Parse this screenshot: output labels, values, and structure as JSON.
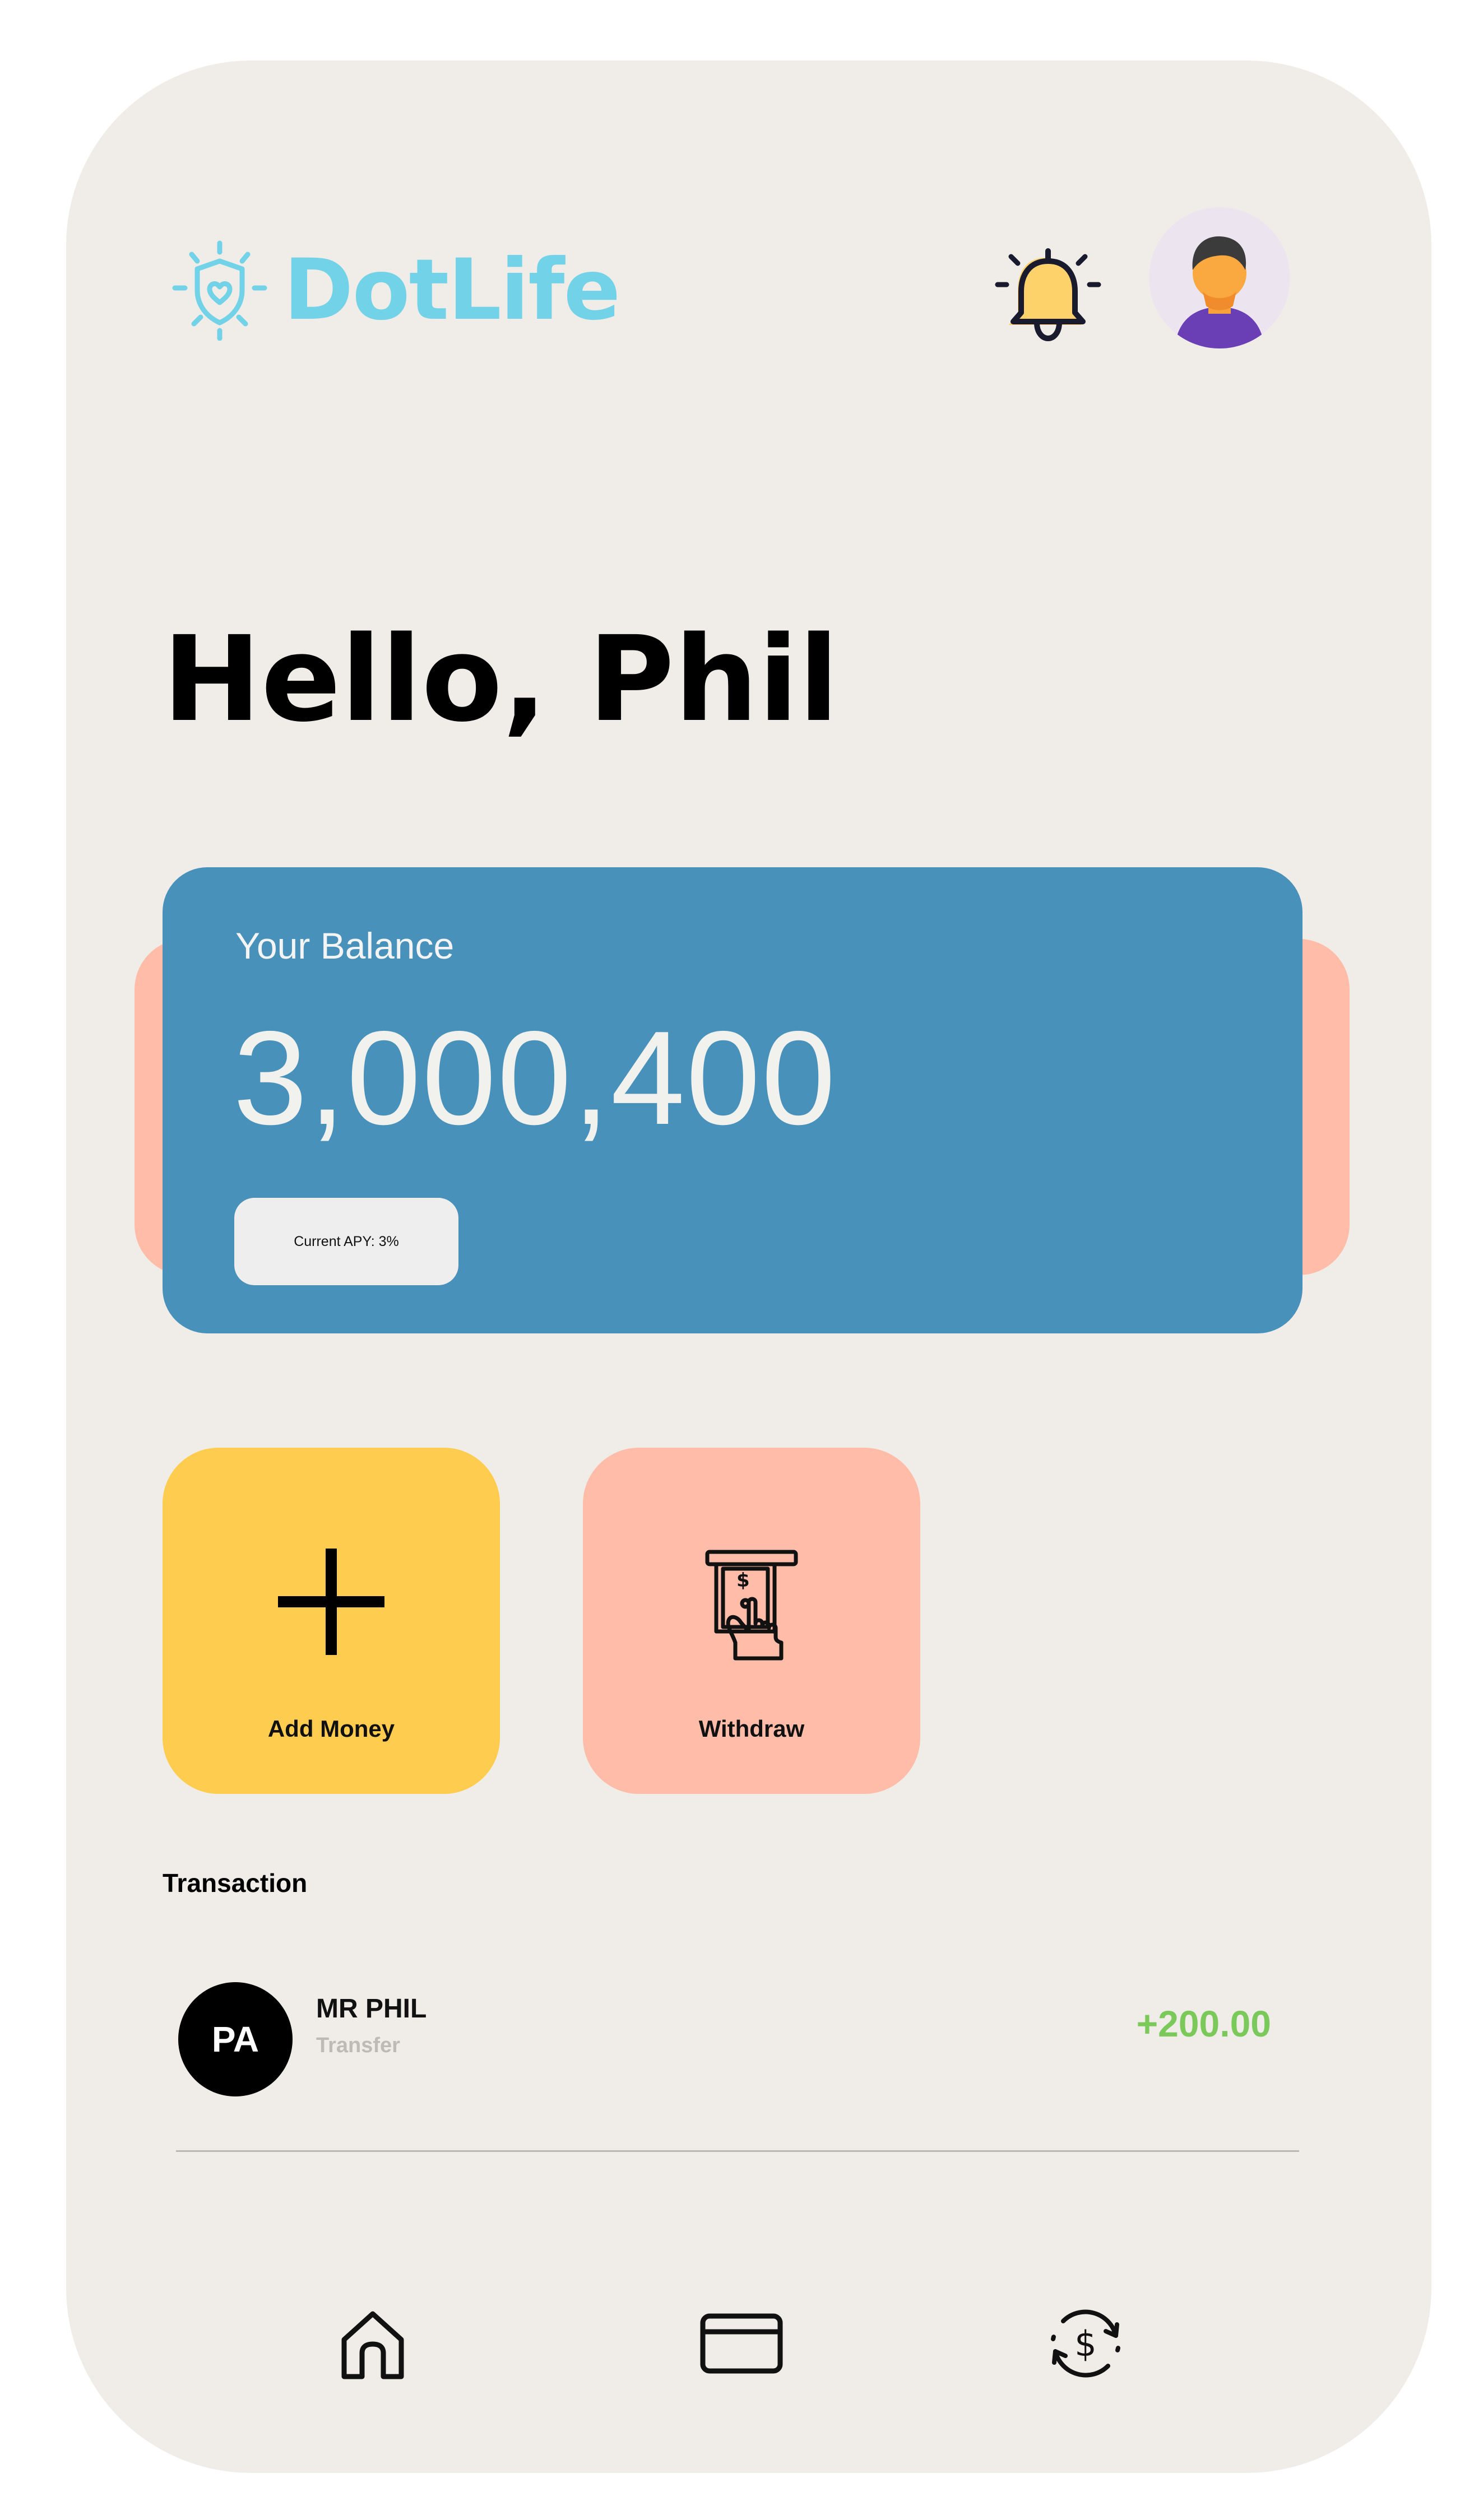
{
  "header": {
    "app_name": "DotLife",
    "logo_icon": "shield-heart-icon",
    "notification_icon": "bell-icon",
    "profile_icon": "user-avatar"
  },
  "greeting": "Hello, Phil",
  "balance": {
    "label": "Your Balance",
    "amount": "3,000,400",
    "apy": "Current APY: 3%"
  },
  "actions": [
    {
      "label": "Add Money",
      "icon": "plus-icon",
      "color": "#fecc4e"
    },
    {
      "label": "Withdraw",
      "icon": "atm-cash-icon",
      "color": "#ffbda9"
    }
  ],
  "transactions": {
    "title": "Transaction",
    "items": [
      {
        "initials": "PA",
        "name": "MR PHIL",
        "type": "Transfer",
        "amount": "+200.00"
      }
    ]
  },
  "nav": [
    {
      "icon": "home-icon"
    },
    {
      "icon": "card-icon"
    },
    {
      "icon": "currency-exchange-icon"
    }
  ],
  "colors": {
    "background": "#f0ede8",
    "brand": "#72d2e8",
    "balance_card": "#4891bb",
    "accent_yellow": "#fecc4e",
    "accent_peach": "#ffbda9",
    "positive": "#7bc95a"
  }
}
